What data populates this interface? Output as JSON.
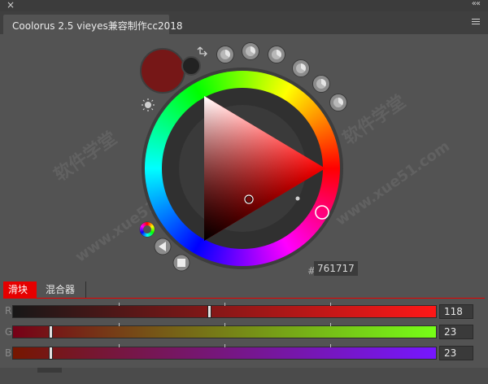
{
  "panel": {
    "title": "Coolorus 2.5 vieyes兼容制作cc2018",
    "close_glyph": "×",
    "collapse_glyph": "««",
    "menu_icon": "menu-icon"
  },
  "color": {
    "current_hex": "761717",
    "hash": "#",
    "current_swatch": "#761717",
    "hue_color": "#ff0000"
  },
  "mode_tabs": [
    {
      "label": "滑块",
      "active": true
    },
    {
      "label": "混合器",
      "active": false
    }
  ],
  "sliders": [
    {
      "label": "R",
      "value": "118",
      "level": 0.463
    },
    {
      "label": "G",
      "value": "23",
      "level": 0.09
    },
    {
      "label": "B",
      "value": "23",
      "level": 0.09
    }
  ],
  "watermark": {
    "left": "软件学堂",
    "left_url": "www.xue51.com",
    "right": "软件学堂",
    "right_url": "www.xue51.com"
  }
}
